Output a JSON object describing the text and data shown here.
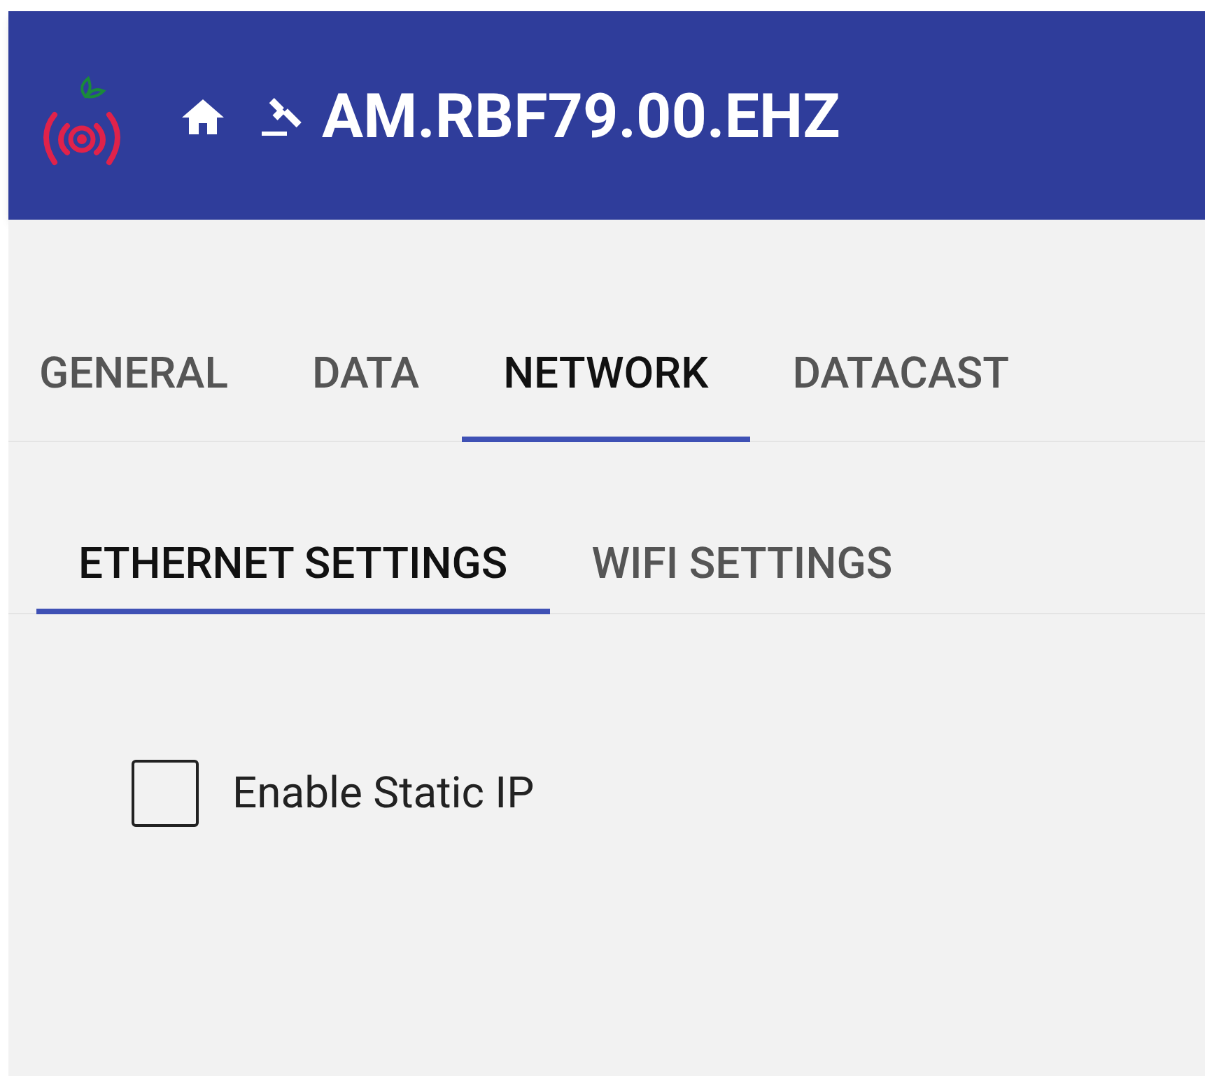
{
  "header": {
    "title": "AM.RBF79.00.EHZ"
  },
  "tabs": [
    {
      "label": "GENERAL",
      "selected": false
    },
    {
      "label": "DATA",
      "selected": false
    },
    {
      "label": "NETWORK",
      "selected": true
    },
    {
      "label": "DATACAST",
      "selected": false
    }
  ],
  "subtabs": [
    {
      "label": "ETHERNET SETTINGS",
      "selected": true
    },
    {
      "label": "WIFI SETTINGS",
      "selected": false
    }
  ],
  "options": [
    {
      "label": "Enable Static IP",
      "checked": false
    }
  ]
}
